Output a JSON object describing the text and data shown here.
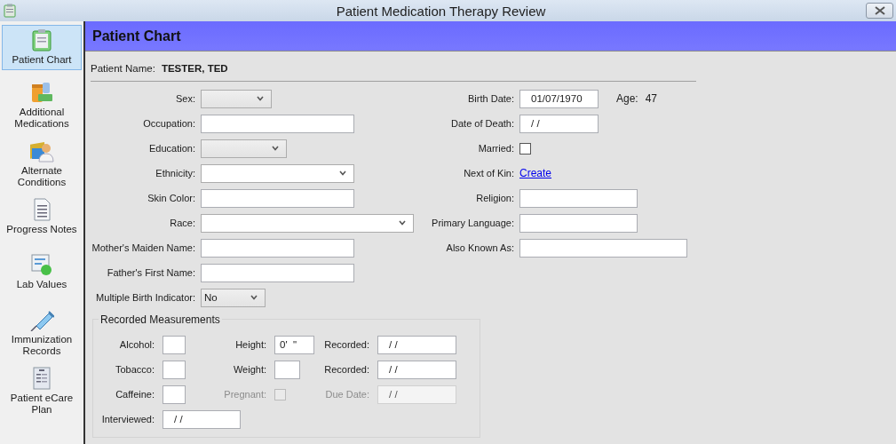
{
  "window": {
    "title": "Patient Medication Therapy Review"
  },
  "sidebar": {
    "items": [
      {
        "label": "Patient Chart",
        "kind": "clipboard",
        "selected": true
      },
      {
        "label": "Additional Medications",
        "kind": "pills",
        "selected": false
      },
      {
        "label": "Alternate Conditions",
        "kind": "person",
        "selected": false
      },
      {
        "label": "Progress Notes",
        "kind": "notes",
        "selected": false
      },
      {
        "label": "Lab Values",
        "kind": "lab",
        "selected": false
      },
      {
        "label": "Immunization Records",
        "kind": "syringe",
        "selected": false
      },
      {
        "label": "Patient eCare Plan",
        "kind": "plan",
        "selected": false
      }
    ]
  },
  "header": {
    "title": "Patient Chart"
  },
  "patient": {
    "label": "Patient Name:",
    "value": "TESTER, TED"
  },
  "left_fields": [
    {
      "label": "Sex:",
      "kind": "select",
      "editable": false
    },
    {
      "label": "Occupation:",
      "kind": "text"
    },
    {
      "label": "Education:",
      "kind": "select",
      "editable": false
    },
    {
      "label": "Ethnicity:",
      "kind": "select",
      "editable": true
    },
    {
      "label": "Skin Color:",
      "kind": "text"
    },
    {
      "label": "Race:",
      "kind": "select",
      "editable": true
    },
    {
      "label": "Mother's Maiden Name:",
      "kind": "text"
    },
    {
      "label": "Father's First Name:",
      "kind": "text"
    },
    {
      "label": "Multiple Birth Indicator:",
      "kind": "select",
      "editable": false,
      "value": "No"
    }
  ],
  "right_fields": [
    {
      "label": "Birth Date:",
      "kind": "text",
      "value": "01/07/1970",
      "note_label": "Age:",
      "note_value": "47"
    },
    {
      "label": "Date of Death:",
      "kind": "text",
      "value": "/ /"
    },
    {
      "label": "Married:",
      "kind": "checkbox",
      "checked": false
    },
    {
      "label": "Next of Kin:",
      "kind": "link",
      "value": "Create"
    },
    {
      "label": "Religion:",
      "kind": "text"
    },
    {
      "label": "Primary Language:",
      "kind": "text"
    },
    {
      "label": "Also Known As:",
      "kind": "text"
    }
  ],
  "measurements": {
    "title": "Recorded Measurements",
    "fields": [
      {
        "label": "Alcohol:",
        "kind": "text",
        "disabled": false
      },
      {
        "label": "Height:",
        "kind": "text",
        "value": "0'  \"",
        "disabled": false
      },
      {
        "label": "Recorded:",
        "kind": "text",
        "value": "/ /",
        "disabled": false
      },
      {
        "label": "Tobacco:",
        "kind": "text",
        "disabled": false
      },
      {
        "label": "Weight:",
        "kind": "text",
        "disabled": false
      },
      {
        "label": "Recorded:",
        "kind": "text",
        "value": "/ /",
        "disabled": false
      },
      {
        "label": "Caffeine:",
        "kind": "text",
        "disabled": false
      },
      {
        "label": "Pregnant:",
        "kind": "checkbox",
        "checked": false,
        "disabled": true
      },
      {
        "label": "Due Date:",
        "kind": "text",
        "value": "/ /",
        "disabled": true
      },
      {
        "label": "Interviewed:",
        "kind": "text",
        "value": "/ /",
        "disabled": false
      }
    ]
  }
}
